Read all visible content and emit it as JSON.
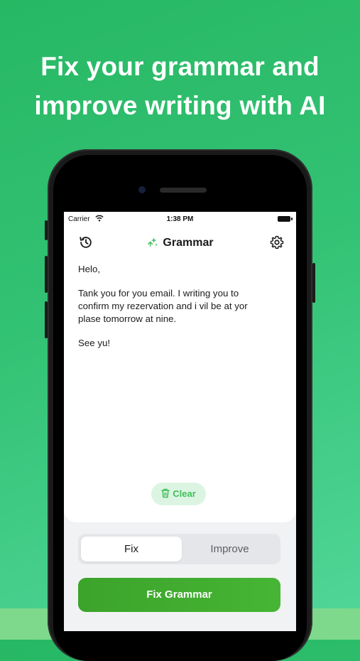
{
  "headline": {
    "line1": "Fix your grammar and",
    "line2": "improve writing with AI"
  },
  "status_bar": {
    "carrier": "Carrier",
    "time": "1:38 PM"
  },
  "nav": {
    "title": "Grammar",
    "left_icon": "history-icon",
    "right_icon": "settings-icon",
    "title_icon": "sparkle-icon"
  },
  "editor": {
    "paragraphs": [
      "Helo,",
      "Tank you for you email. I writing you to\nconfirm my rezervation and i vil be at yor\nplase tomorrow at nine.",
      "See yu!"
    ]
  },
  "clear_button": {
    "label": "Clear",
    "icon": "trash-icon"
  },
  "mode_tabs": [
    {
      "label": "Fix",
      "selected": true
    },
    {
      "label": "Improve",
      "selected": false
    }
  ],
  "primary_button": {
    "label": "Fix Grammar"
  },
  "colors": {
    "accent": "#46b534",
    "clear_bg": "#dcf5e2",
    "clear_text": "#3fbe5a",
    "background_green": "#33c274"
  }
}
